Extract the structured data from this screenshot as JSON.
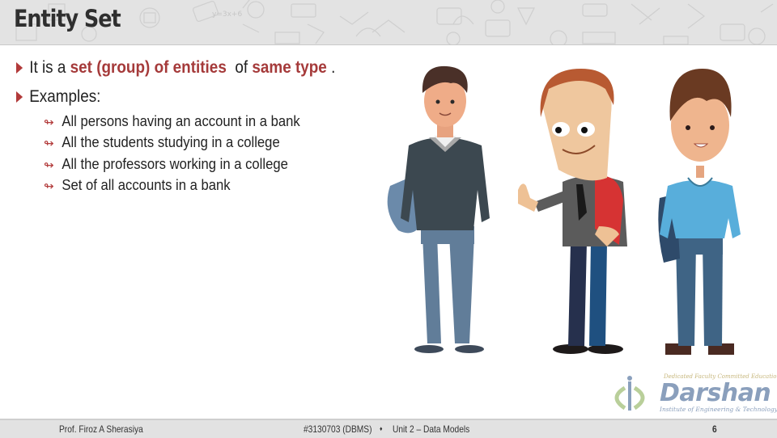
{
  "slide": {
    "title": "Entity Set",
    "bullets": [
      {
        "parts": [
          {
            "text": "It is a ",
            "highlight": false
          },
          {
            "text": "set (group) of entities",
            "highlight": true
          },
          {
            "text": "  of ",
            "highlight": false
          },
          {
            "text": "same type",
            "highlight": true
          },
          {
            "text": " .",
            "highlight": false
          }
        ]
      },
      {
        "parts": [
          {
            "text": "Examples:",
            "highlight": false
          }
        ]
      }
    ],
    "examples": [
      "All persons having an account in a bank",
      "All the students studying in a college",
      "All the professors working in a college",
      "Set of all accounts in a bank"
    ],
    "highlight_color": "#a53a3a",
    "bullet_icon": "triangle-right-icon",
    "sub_bullet_icon": "curved-arrow-right-icon"
  },
  "illustration": {
    "description": "Three cartoon students standing",
    "figures": [
      "student-with-gray-sweater",
      "student-waving-red-backpack",
      "student-blue-shirt"
    ]
  },
  "logo": {
    "tagline": "Dedicated Faculty Committed Education",
    "name": "Darshan",
    "subtitle": "Institute of Engineering & Technology"
  },
  "footer": {
    "author": "Prof. Firoz A Sherasiya",
    "course": "#3130703 (DBMS)",
    "separator": "♦",
    "unit": "Unit 2 – Data Models",
    "page_number": "6"
  }
}
